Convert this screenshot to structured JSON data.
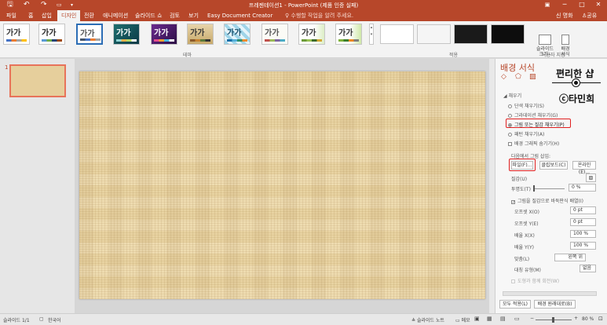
{
  "titlebar": {
    "title": "프레젠테이션1 - PowerPoint (제품 인증 실패)",
    "save_icon": "save-icon",
    "undo_icon": "undo-icon",
    "redo_icon": "redo-icon",
    "minimize": "─",
    "maximize": "□",
    "close": "✕"
  },
  "menu": {
    "items": [
      "파일",
      "홈",
      "삽입",
      "디자인",
      "전환",
      "애니메이션",
      "슬라이드 쇼",
      "검토",
      "보기",
      "Easy Document Creator"
    ],
    "active_index": 3,
    "tell_me": "수행할 작업을 알려 주세요.",
    "user": "신 명화",
    "share": "공유"
  },
  "ribbon": {
    "themes_label": "테마",
    "variants_label": "적용",
    "customize_label": "사용자 지정",
    "theme_glyph": "가가",
    "slide_size": "슬라이드\n크기 -",
    "background_format": "배경\n서식"
  },
  "slide_panel": {
    "slide_number": "1"
  },
  "format_pane": {
    "title": "배경 서식",
    "section": "채우기",
    "fill_options": [
      "단색 채우기(S)",
      "그라데이션 채우기(G)",
      "그림 또는 질감 채우기(P)",
      "패턴 채우기(A)"
    ],
    "selected_fill": 2,
    "hide_background_graphics": "배경 그래픽 숨기기(H)",
    "insert_picture_from": "다음에서 그림 삽입:",
    "file_button": "파일(F)...",
    "clipboard_button": "클립보드(C)",
    "online_button": "온라인(E)...",
    "texture_label": "질감(U)",
    "transparency_label": "투명도(T)",
    "transparency_value": "0 %",
    "tile_checkbox": "그림을 질감으로 바둑판식 배열(I)",
    "offset_x_label": "오프셋 X(O)",
    "offset_x_value": "0 pt",
    "offset_y_label": "오프셋 Y(E)",
    "offset_y_value": "0 pt",
    "scale_x_label": "배율 X(X)",
    "scale_x_value": "100 %",
    "scale_y_label": "배율 Y(Y)",
    "scale_y_value": "100 %",
    "align_label": "맞춤(L)",
    "align_value": "왼쪽 위",
    "mirror_label": "대칭 유형(M)",
    "mirror_value": "없음",
    "rotate_with_shape": "도형과 함께 회전(W)",
    "apply_all_button": "모두 적용(L)",
    "reset_button": "배경 원래대로(B)"
  },
  "watermark": {
    "title": "편리한 샵",
    "credit": "ⓒ타민희"
  },
  "status": {
    "slide_info": "슬라이드 1/1",
    "language": "한국어",
    "notes": "슬라이드 노트",
    "comments": "메모",
    "zoom": "80 %"
  },
  "colors": {
    "accent": "#b7472a",
    "highlight": "#e02020"
  }
}
